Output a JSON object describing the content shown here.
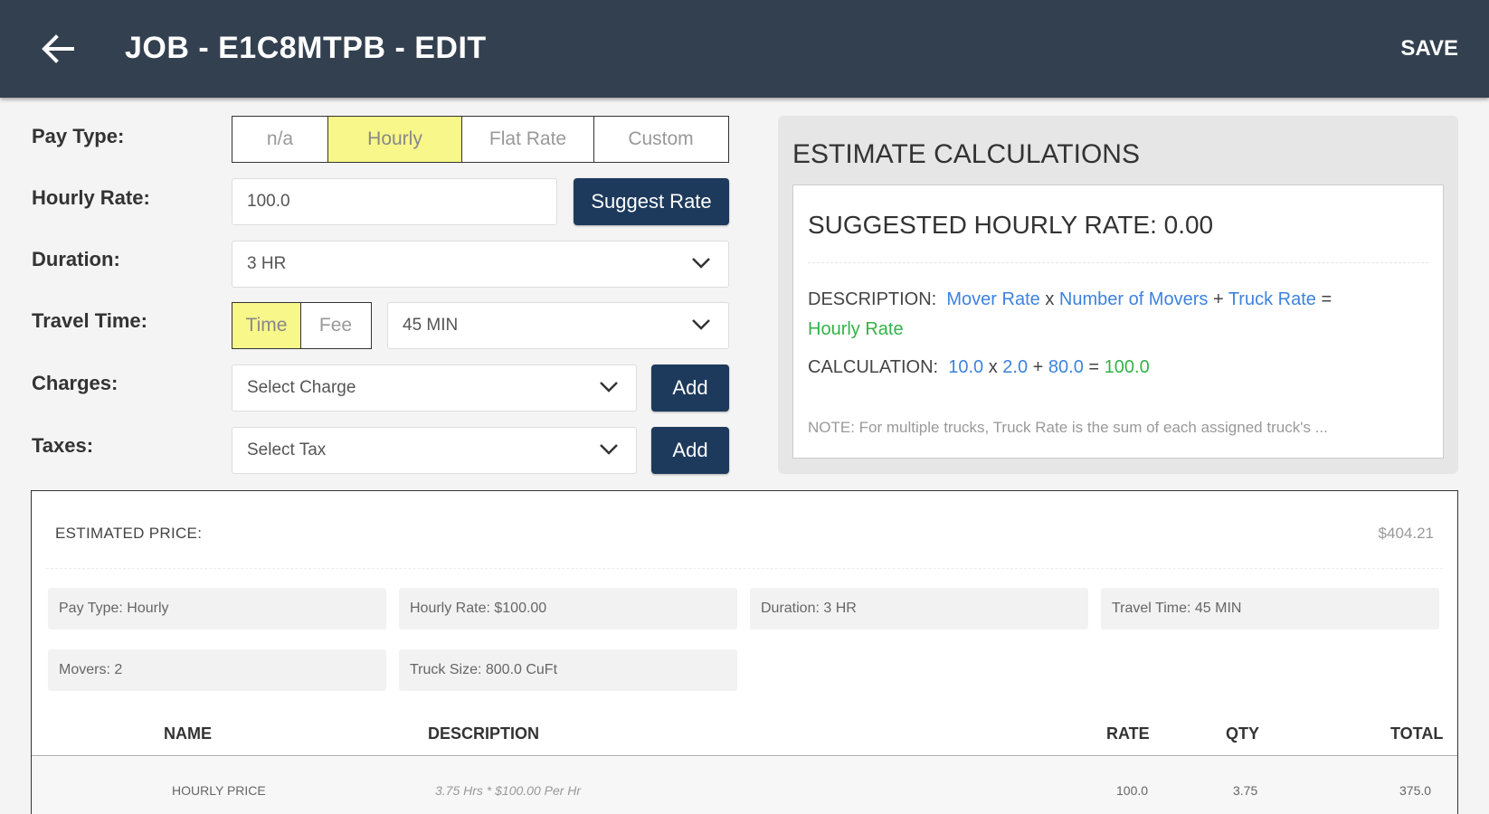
{
  "header": {
    "title": "JOB - E1C8MTPB - EDIT",
    "save_label": "SAVE"
  },
  "form": {
    "pay_type": {
      "label": "Pay Type:",
      "options": [
        "n/a",
        "Hourly",
        "Flat Rate",
        "Custom"
      ],
      "selected": "Hourly"
    },
    "hourly_rate": {
      "label": "Hourly Rate:",
      "value": "100.0",
      "suggest_label": "Suggest Rate"
    },
    "duration": {
      "label": "Duration:",
      "value": "3 HR"
    },
    "travel_time": {
      "label": "Travel Time:",
      "options": [
        "Time",
        "Fee"
      ],
      "selected": "Time",
      "value": "45 MIN"
    },
    "charges": {
      "label": "Charges:",
      "placeholder": "Select Charge",
      "add_label": "Add"
    },
    "taxes": {
      "label": "Taxes:",
      "placeholder": "Select Tax",
      "add_label": "Add"
    }
  },
  "estimate": {
    "title": "ESTIMATE CALCULATIONS",
    "suggested": "SUGGESTED HOURLY RATE: 0.00",
    "description": {
      "label": "DESCRIPTION:",
      "term1": "Mover Rate",
      "op1": "x",
      "term2": "Number of Movers",
      "op2": "+",
      "term3": "Truck Rate",
      "op3": "=",
      "result": "Hourly Rate"
    },
    "calculation": {
      "label": "CALCULATION:",
      "v1": "10.0",
      "op1": "x",
      "v2": "2.0",
      "op2": "+",
      "v3": "80.0",
      "op3": "=",
      "result": "100.0"
    },
    "note": "NOTE: For multiple trucks, Truck Rate is the sum of each assigned truck's ..."
  },
  "price": {
    "label": "ESTIMATED PRICE:",
    "value": "$404.21",
    "summary": [
      "Pay Type: Hourly",
      "Hourly Rate: $100.00",
      "Duration: 3 HR",
      "Travel Time: 45 MIN",
      "Movers: 2",
      "Truck Size: 800.0 CuFt"
    ],
    "columns": {
      "name": "NAME",
      "description": "DESCRIPTION",
      "rate": "RATE",
      "qty": "QTY",
      "total": "TOTAL"
    },
    "rows": [
      {
        "name": "HOURLY PRICE",
        "description": "3.75 Hrs * $100.00 Per Hr",
        "rate": "100.0",
        "qty": "3.75",
        "total": "375.0"
      }
    ]
  },
  "colors": {
    "header_bg": "#33404f",
    "button_dark": "#1d3a5c",
    "segment_active": "#f7f78a",
    "link_blue": "#3d82e0",
    "result_green": "#33b24a"
  },
  "icons": {
    "back": "arrow-left-icon",
    "dropdown": "chevron-down-icon"
  }
}
